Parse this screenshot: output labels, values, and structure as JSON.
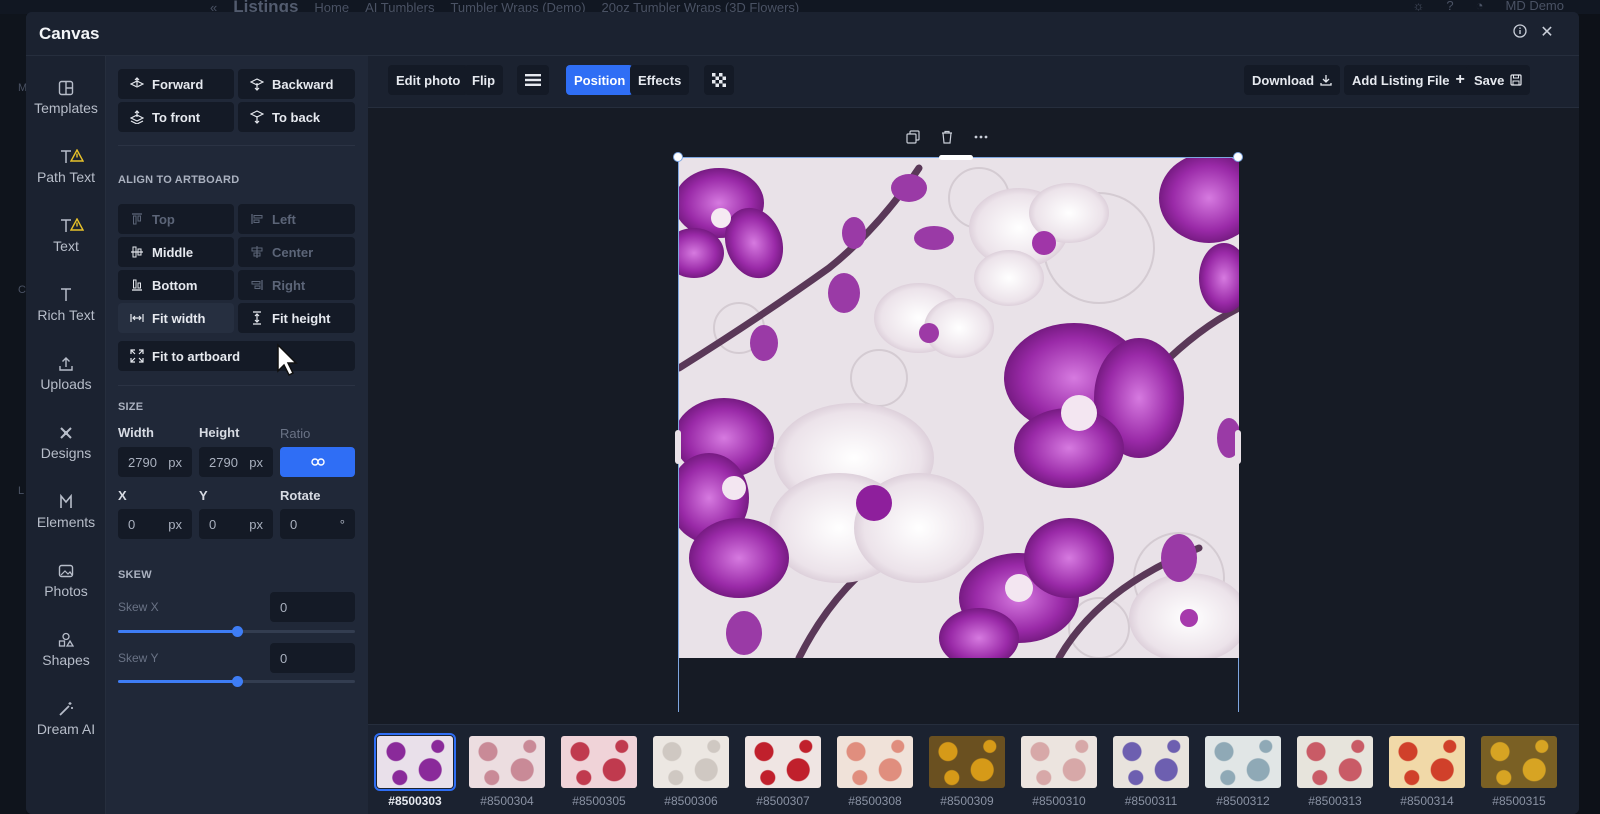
{
  "background": {
    "crumbs": [
      "Listings",
      "Home",
      "AI Tumblers",
      "Tumbler Wraps (Demo)",
      "20oz Tumbler Wraps (3D Flowers)"
    ],
    "user": "MD Demo",
    "left_letters": [
      "M",
      "C",
      "L"
    ]
  },
  "modal": {
    "title": "Canvas"
  },
  "rail": [
    {
      "label": "Templates",
      "icon": "templates-icon"
    },
    {
      "label": "Path Text",
      "icon": "path-text-icon",
      "warning": true
    },
    {
      "label": "Text",
      "icon": "text-icon",
      "warning": true
    },
    {
      "label": "Rich Text",
      "icon": "rich-text-icon"
    },
    {
      "label": "Uploads",
      "icon": "upload-icon"
    },
    {
      "label": "Designs",
      "icon": "designs-icon"
    },
    {
      "label": "Elements",
      "icon": "elements-icon"
    },
    {
      "label": "Photos",
      "icon": "photos-icon"
    },
    {
      "label": "Shapes",
      "icon": "shapes-icon"
    },
    {
      "label": "Dream AI",
      "icon": "dream-ai-icon"
    }
  ],
  "layer": {
    "forward": "Forward",
    "backward": "Backward",
    "to_front": "To front",
    "to_back": "To back"
  },
  "align": {
    "heading": "ALIGN TO ARTBOARD",
    "top": "Top",
    "left": "Left",
    "middle": "Middle",
    "center": "Center",
    "bottom": "Bottom",
    "right": "Right",
    "fit_width": "Fit width",
    "fit_height": "Fit height",
    "fit_artboard": "Fit to artboard"
  },
  "size": {
    "heading": "SIZE",
    "width_label": "Width",
    "height_label": "Height",
    "ratio_label": "Ratio",
    "width": "2790",
    "height": "2790",
    "unit": "px",
    "x_label": "X",
    "y_label": "Y",
    "rotate_label": "Rotate",
    "x": "0",
    "y": "0",
    "rotate": "0",
    "deg": "°"
  },
  "skew": {
    "heading": "SKEW",
    "x_label": "Skew X",
    "x_value": "0",
    "x_level": 0.5,
    "y_label": "Skew Y",
    "y_value": "0",
    "y_level": 0.5
  },
  "toolbar": {
    "edit_photo": "Edit photo",
    "flip": "Flip",
    "position": "Position",
    "effects": "Effects",
    "download": "Download",
    "add_listing": "Add Listing File",
    "save": "Save"
  },
  "thumbnails": [
    {
      "code": "#8500303",
      "selected": true,
      "c1": "#8a2a9a",
      "c2": "#e9e0ea"
    },
    {
      "code": "#8500304",
      "c1": "#c98a97",
      "c2": "#ecdde0"
    },
    {
      "code": "#8500305",
      "c1": "#c03a4e",
      "c2": "#f0d3d8"
    },
    {
      "code": "#8500306",
      "c1": "#cfc8c2",
      "c2": "#ece7e2"
    },
    {
      "code": "#8500307",
      "c1": "#c0202c",
      "c2": "#efe5e3"
    },
    {
      "code": "#8500308",
      "c1": "#e08e7e",
      "c2": "#f0e2d9"
    },
    {
      "code": "#8500309",
      "c1": "#d69a18",
      "c2": "#6a5020"
    },
    {
      "code": "#8500310",
      "c1": "#d7a8a8",
      "c2": "#ece4df"
    },
    {
      "code": "#8500311",
      "c1": "#6d5fb0",
      "c2": "#e8e3dd"
    },
    {
      "code": "#8500312",
      "c1": "#8fa9b6",
      "c2": "#e1e6e6"
    },
    {
      "code": "#8500313",
      "c1": "#c95b66",
      "c2": "#e7e4dc"
    },
    {
      "code": "#8500314",
      "c1": "#d0402a",
      "c2": "#f1d9a8"
    },
    {
      "code": "#8500315",
      "c1": "#d7a423",
      "c2": "#7a6024"
    }
  ],
  "colors": {
    "accent": "#2f6ef5",
    "panel": "#202838",
    "workspace": "#161b25"
  }
}
